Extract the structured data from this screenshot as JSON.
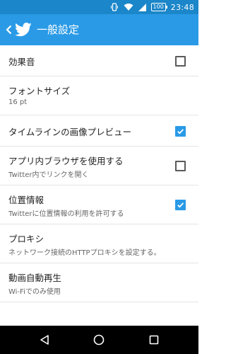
{
  "status_bar": {
    "battery": "100",
    "time": "23:48",
    "icons": [
      "vibrate-icon",
      "wifi-icon",
      "signal-icon",
      "battery-icon"
    ]
  },
  "app_bar": {
    "title": "一般設定",
    "background": "#2a9ae6",
    "back_icon": "chevron-left-icon",
    "logo_icon": "twitter-bird-icon"
  },
  "settings": [
    {
      "label": "効果音",
      "sub": "",
      "checkbox": true,
      "checked": false
    },
    {
      "label": "フォントサイズ",
      "sub": "16 pt",
      "checkbox": false
    },
    {
      "label": "タイムラインの画像プレビュー",
      "sub": "",
      "checkbox": true,
      "checked": true
    },
    {
      "label": "アプリ内ブラウザを使用する",
      "sub": "Twitter内でリンクを開く",
      "checkbox": true,
      "checked": false
    },
    {
      "label": "位置情報",
      "sub": "Twitterに位置情報の利用を許可する",
      "checkbox": true,
      "checked": true
    },
    {
      "label": "プロキシ",
      "sub": "ネットワーク接続のHTTPプロキシを設定する。",
      "checkbox": false
    },
    {
      "label": "動画自動再生",
      "sub": "Wi-Fiでのみ使用",
      "checkbox": false
    }
  ],
  "nav_bar": {
    "icons": [
      "back-triangle-icon",
      "home-circle-icon",
      "recents-square-icon"
    ]
  }
}
